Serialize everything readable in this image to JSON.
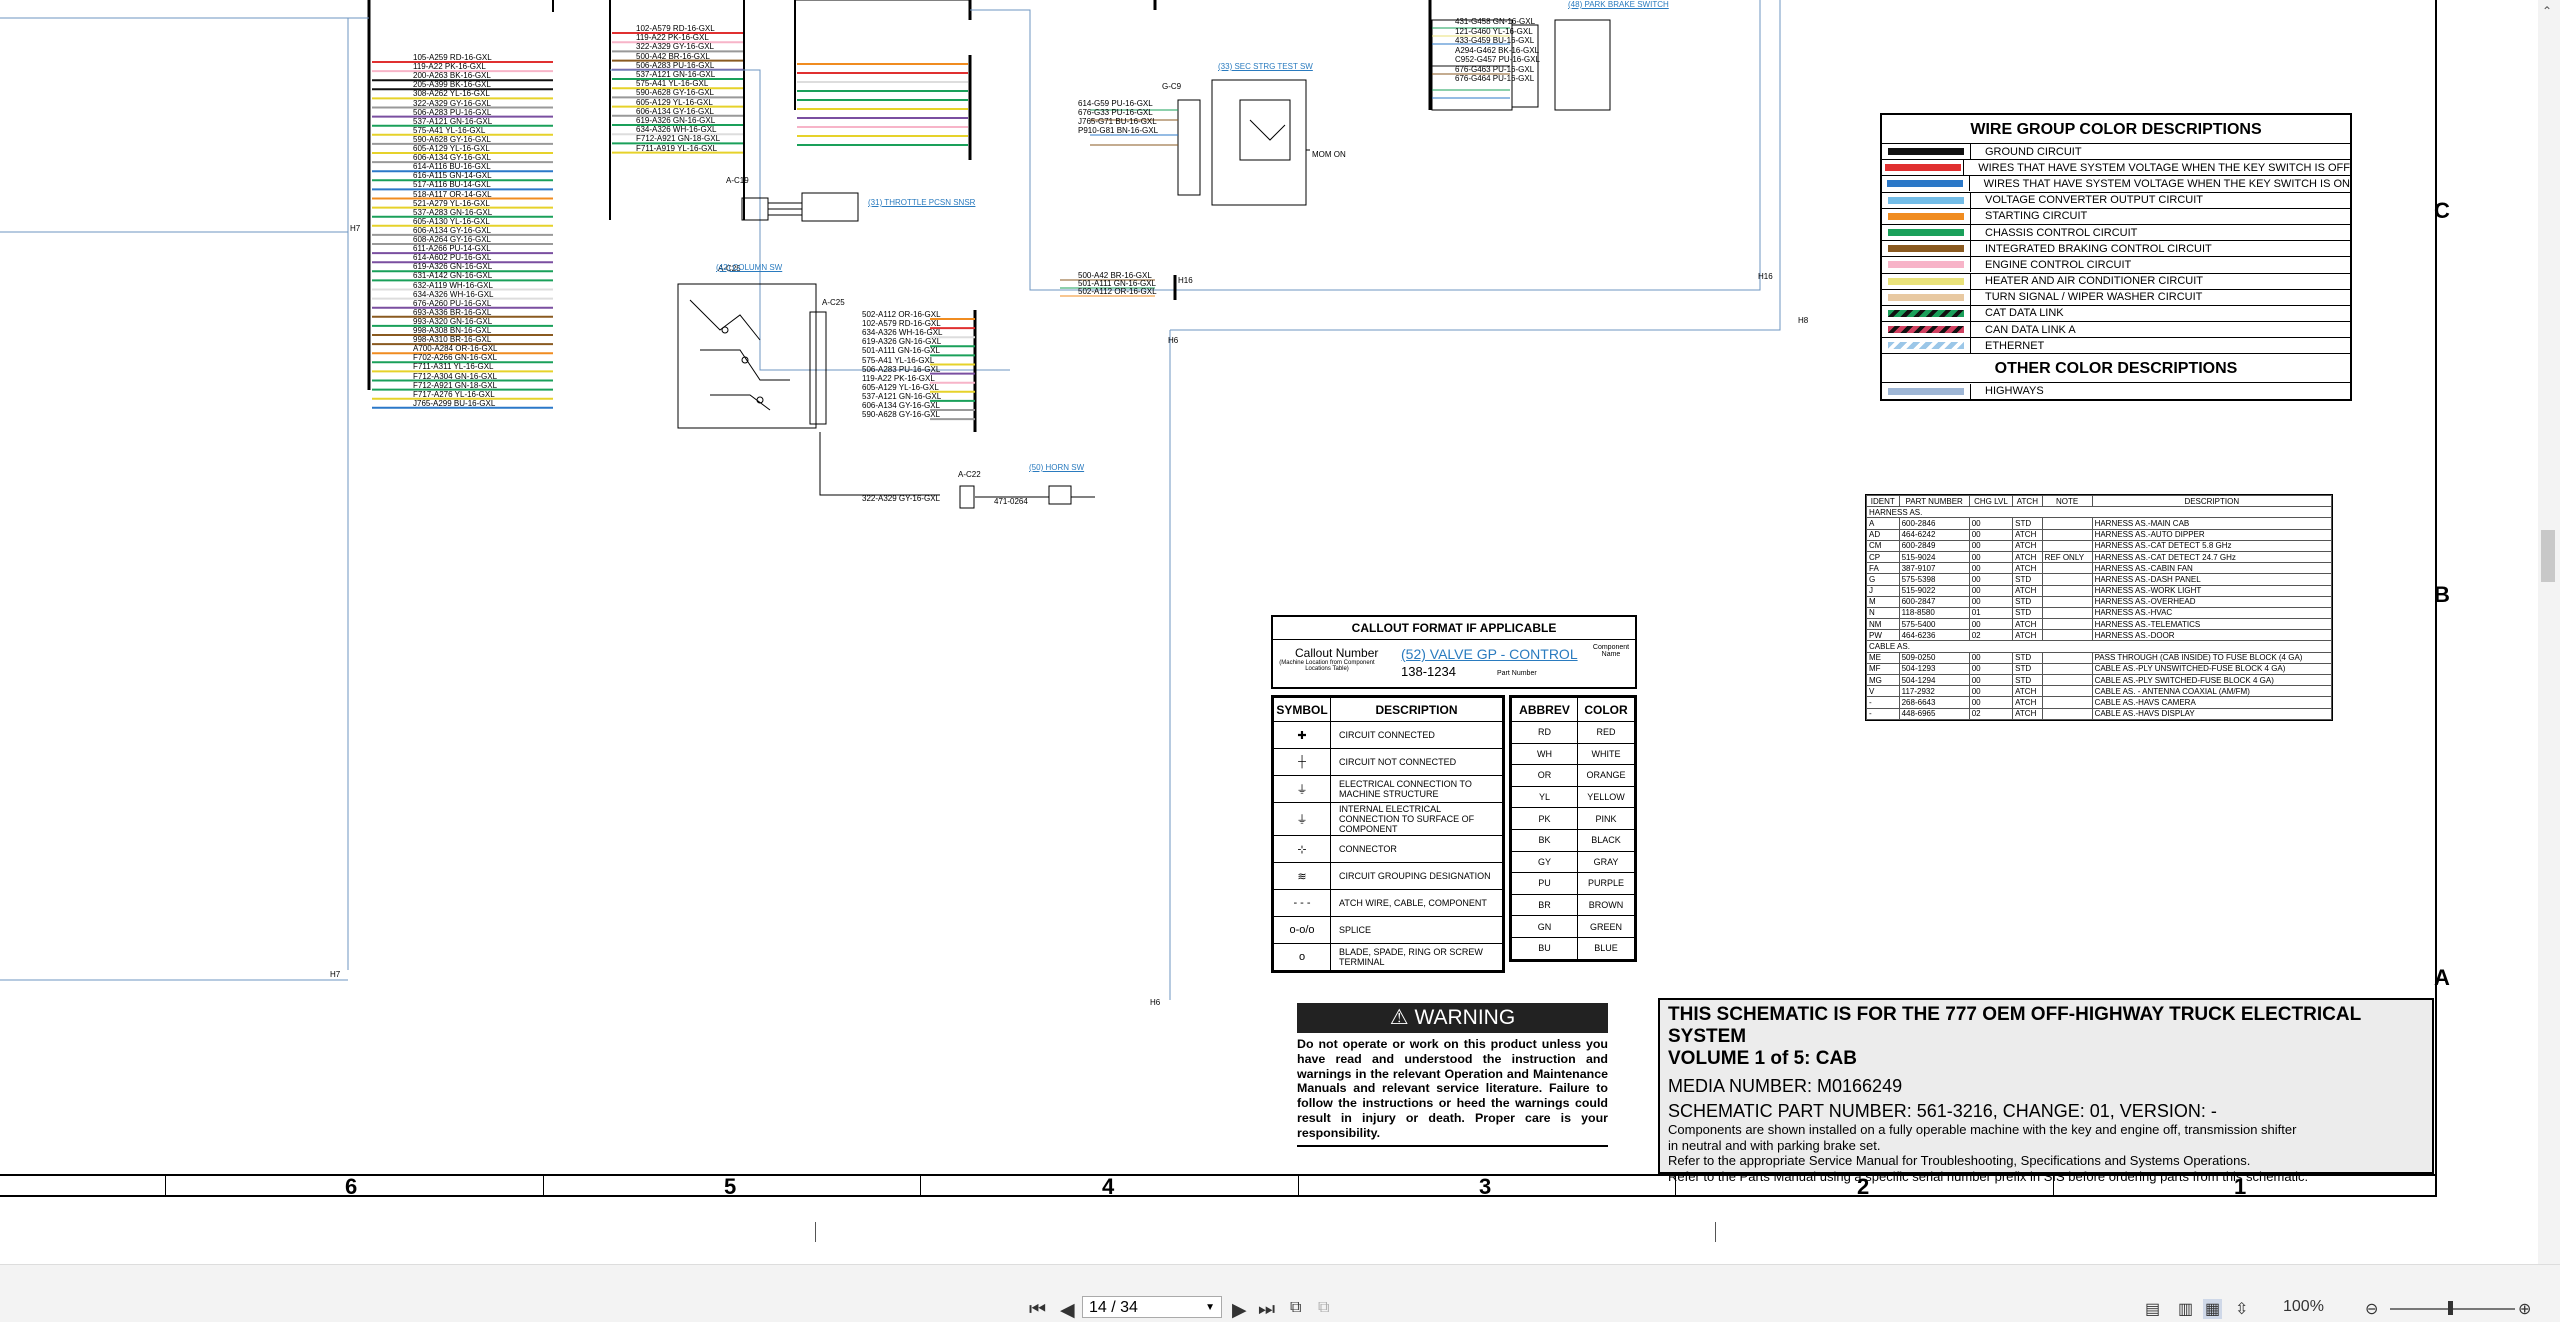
{
  "wire_group": {
    "title": "WIRE GROUP COLOR DESCRIPTIONS",
    "rows": [
      {
        "label": "GROUND CIRCUIT",
        "color": "#111111",
        "style": "solid"
      },
      {
        "label": "WIRES THAT HAVE SYSTEM VOLTAGE WHEN THE KEY SWITCH IS OFF",
        "color": "#e03030",
        "style": "solid"
      },
      {
        "label": "WIRES THAT HAVE SYSTEM VOLTAGE WHEN THE KEY SWITCH IS ON",
        "color": "#2b78c8",
        "style": "solid"
      },
      {
        "label": "VOLTAGE CONVERTER OUTPUT CIRCUIT",
        "color": "#73bde8",
        "style": "solid"
      },
      {
        "label": "STARTING CIRCUIT",
        "color": "#f08c20",
        "style": "solid"
      },
      {
        "label": "CHASSIS CONTROL CIRCUIT",
        "color": "#1aa05a",
        "style": "solid"
      },
      {
        "label": "INTEGRATED BRAKING CONTROL CIRCUIT",
        "color": "#8a5a20",
        "style": "solid"
      },
      {
        "label": "ENGINE CONTROL CIRCUIT",
        "color": "#f7b4c8",
        "style": "solid"
      },
      {
        "label": "HEATER AND AIR CONDITIONER CIRCUIT",
        "color": "#e9e27a",
        "style": "solid"
      },
      {
        "label": "TURN SIGNAL / WIPER WASHER CIRCUIT",
        "color": "#e8c9a2",
        "style": "solid"
      },
      {
        "label": "CAT DATA LINK",
        "color": "#1aa05a",
        "style": "stripe-dark"
      },
      {
        "label": "CAN DATA LINK A",
        "color": "#d04060",
        "style": "stripe-dark"
      },
      {
        "label": "ETHERNET",
        "color": "#9cc7e8",
        "style": "stripe-light"
      }
    ],
    "other_title": "OTHER COLOR DESCRIPTIONS",
    "other_rows": [
      {
        "label": "HIGHWAYS",
        "color": "#9fb7d6",
        "style": "solid"
      }
    ]
  },
  "callout": {
    "title": "CALLOUT FORMAT IF APPLICABLE",
    "callout_number": "Callout Number",
    "callout_sub": "(Machine Location from Component Locations Table)",
    "link": "(52) VALVE GP - CONTROL",
    "part": "138-1234",
    "component_name": "Component Name",
    "part_number": "Part Number"
  },
  "symbols": {
    "h_symbol": "SYMBOL",
    "h_desc": "DESCRIPTION",
    "rows": [
      {
        "sym": "✚",
        "desc": "CIRCUIT CONNECTED"
      },
      {
        "sym": "┼",
        "desc": "CIRCUIT NOT CONNECTED"
      },
      {
        "sym": "⏚",
        "desc": "ELECTRICAL CONNECTION TO MACHINE STRUCTURE"
      },
      {
        "sym": "⏚",
        "desc": "INTERNAL ELECTRICAL CONNECTION TO SURFACE OF COMPONENT"
      },
      {
        "sym": "⊹",
        "desc": "CONNECTOR"
      },
      {
        "sym": "≋",
        "desc": "CIRCUIT GROUPING DESIGNATION"
      },
      {
        "sym": "- - -",
        "desc": "ATCH WIRE, CABLE, COMPONENT"
      },
      {
        "sym": "o-o/o",
        "desc": "SPLICE"
      },
      {
        "sym": "o",
        "desc": "BLADE, SPADE, RING OR SCREW TERMINAL"
      }
    ]
  },
  "abbrevs": {
    "h_abbrev": "ABBREV",
    "h_color": "COLOR",
    "rows": [
      [
        "RD",
        "RED"
      ],
      [
        "WH",
        "WHITE"
      ],
      [
        "OR",
        "ORANGE"
      ],
      [
        "YL",
        "YELLOW"
      ],
      [
        "PK",
        "PINK"
      ],
      [
        "BK",
        "BLACK"
      ],
      [
        "GY",
        "GRAY"
      ],
      [
        "PU",
        "PURPLE"
      ],
      [
        "BR",
        "BROWN"
      ],
      [
        "GN",
        "GREEN"
      ],
      [
        "BU",
        "BLUE"
      ]
    ]
  },
  "parts": {
    "headers": [
      "IDENT",
      "PART NUMBER",
      "CHG LVL",
      "ATCH",
      "NOTE",
      "DESCRIPTION"
    ],
    "group1": "HARNESS AS.",
    "rows1": [
      [
        "A",
        "600-2846",
        "00",
        "STD",
        "",
        "HARNESS AS.-MAIN CAB"
      ],
      [
        "AD",
        "464-6242",
        "00",
        "ATCH",
        "",
        "HARNESS AS.-AUTO DIPPER"
      ],
      [
        "CM",
        "600-2849",
        "00",
        "ATCH",
        "",
        "HARNESS AS.-CAT DETECT 5.8 GHz"
      ],
      [
        "CP",
        "515-9024",
        "00",
        "ATCH",
        "REF ONLY",
        "HARNESS AS.-CAT DETECT 24.7 GHz"
      ],
      [
        "FA",
        "387-9107",
        "00",
        "ATCH",
        "",
        "HARNESS AS.-CABIN FAN"
      ],
      [
        "G",
        "575-5398",
        "00",
        "STD",
        "",
        "HARNESS AS.-DASH PANEL"
      ],
      [
        "J",
        "515-9022",
        "00",
        "ATCH",
        "",
        "HARNESS AS.-WORK LIGHT"
      ],
      [
        "M",
        "600-2847",
        "00",
        "STD",
        "",
        "HARNESS AS.-OVERHEAD"
      ],
      [
        "N",
        "118-8580",
        "01",
        "STD",
        "",
        "HARNESS AS.-HVAC"
      ],
      [
        "NM",
        "575-5400",
        "00",
        "ATCH",
        "",
        "HARNESS AS.-TELEMATICS"
      ],
      [
        "PW",
        "464-6236",
        "02",
        "ATCH",
        "",
        "HARNESS AS.-DOOR"
      ]
    ],
    "group2": "CABLE AS.",
    "rows2": [
      [
        "ME",
        "509-0250",
        "00",
        "STD",
        "",
        "PASS THROUGH (CAB INSIDE) TO FUSE BLOCK (4 GA)"
      ],
      [
        "MF",
        "504-1293",
        "00",
        "STD",
        "",
        "CABLE AS.-PLY UNSWITCHED-FUSE BLOCK 4 GA)"
      ],
      [
        "MG",
        "504-1294",
        "00",
        "STD",
        "",
        "CABLE AS.-PLY SWITCHED-FUSE BLOCK 4 GA)"
      ],
      [
        "V",
        "117-2932",
        "00",
        "ATCH",
        "",
        "CABLE AS. - ANTENNA COAXIAL (AM/FM)"
      ],
      [
        "-",
        "268-6643",
        "00",
        "ATCH",
        "",
        "CABLE AS.-HAVS CAMERA"
      ],
      [
        "-",
        "448-6965",
        "02",
        "ATCH",
        "",
        "CABLE AS.-HAVS DISPLAY"
      ]
    ]
  },
  "warning": {
    "title": "WARNING",
    "text": "Do not operate or work on this product unless you have read and understood the instruction and warnings in the relevant Operation and Maintenance Manuals and relevant service literature. Failure to follow the instructions or heed the warnings could result in injury or death. Proper care is your responsibility."
  },
  "title_block": {
    "line1": "THIS SCHEMATIC IS FOR THE 777 OEM OFF-HIGHWAY TRUCK ELECTRICAL SYSTEM",
    "line2": "VOLUME 1 of 5: CAB",
    "media": "MEDIA NUMBER: M0166249",
    "part": "SCHEMATIC PART NUMBER: 561-3216, CHANGE: 01, VERSION: -",
    "notes": [
      "Components are shown installed on a fully operable machine with the key and engine off, transmission shifter",
      "in neutral and with parking brake set.",
      "Refer to the appropriate Service Manual for Troubleshooting, Specifications and Systems Operations.",
      "Refer to the Parts Manual using a specific serial number prefix in SIS before ordering parts from this schematic."
    ]
  },
  "zones": [
    "6",
    "5",
    "4",
    "3",
    "2",
    "1"
  ],
  "row_labels": [
    "C",
    "B",
    "A"
  ],
  "schematic": {
    "links": [
      "(42) COLUMN SW",
      "(31) THROTTLE PCSN SNSR",
      "(33) SEC STRG TEST SW",
      "(50) HORN SW",
      "(48) PARK BRAKE SWITCH"
    ],
    "connectors": [
      "G-C9",
      "A-C19",
      "A-C25",
      "A-C22"
    ],
    "highways": [
      "H7",
      "H7",
      "H6",
      "H6",
      "H16",
      "H16",
      "H8"
    ],
    "mom_on": "MOM ON",
    "wires_left": [
      "105-A259 RD-16-GXL",
      "119-A22 PK-16-GXL",
      "200-A263 BK-16-GXL",
      "205-A399 BK-16-GXL",
      "308-A262 YL-16-GXL",
      "322-A329 GY-16-GXL",
      "506-A283 PU-16-GXL",
      "537-A121 GN-16-GXL",
      "575-A41 YL-16-GXL",
      "590-A628 GY-16-GXL",
      "605-A129 YL-16-GXL",
      "606-A134 GY-16-GXL",
      "614-A116 BU-16-GXL",
      "616-A115 GN-14-GXL",
      "517-A116 BU-14-GXL",
      "518-A117 OR-14-GXL",
      "521-A279 YL-16-GXL",
      "537-A283 GN-16-GXL",
      "605-A130 YL-16-GXL",
      "606-A134 GY-16-GXL",
      "608-A264 GY-16-GXL",
      "611-A266 PU-14-GXL",
      "614-A602 PU-16-GXL",
      "619-A326 GN-16-GXL",
      "631-A142 GN-16-GXL",
      "632-A119 WH-16-GXL",
      "634-A326 WH-16-GXL",
      "676-A260 PU-16-GXL",
      "693-A336 BR-16-GXL",
      "993-A320 GN-16-GXL",
      "998-A308 BN-16-GXL",
      "998-A310 BR-16-GXL",
      "A700-A284 OR-16-GXL",
      "F702-A266 GN-16-GXL",
      "F711-A311 YL-16-GXL",
      "F712-A304 GN-16-GXL",
      "F712-A921 GN-18-GXL",
      "F717-A276 YL-16-GXL",
      "J765-A299 BU-16-GXL"
    ],
    "wires_mid": [
      "102-A579 RD-16-GXL",
      "119-A22 PK-16-GXL",
      "322-A329 GY-16-GXL",
      "500-A42 BR-16-GXL",
      "506-A283 PU-16-GXL",
      "537-A121 GN-16-GXL",
      "575-A41 YL-16-GXL",
      "590-A628 GY-16-GXL",
      "605-A129 YL-16-GXL",
      "606-A134 GY-16-GXL",
      "619-A326 GN-16-GXL",
      "634-A326 WH-16-GXL",
      "F712-A921 GN-18-GXL",
      "F711-A919 YL-16-GXL"
    ],
    "wires_c25": [
      "502-A112 OR-16-GXL",
      "102-A579 RD-16-GXL",
      "634-A326 WH-16-GXL",
      "619-A326 GN-16-GXL",
      "501-A111 GN-16-GXL",
      "575-A41 YL-16-GXL",
      "506-A283 PU-16-GXL",
      "119-A22 PK-16-GXL",
      "605-A129 YL-16-GXL",
      "537-A121 GN-16-GXL",
      "606-A134 GY-16-GXL",
      "590-A628 GY-16-GXL"
    ],
    "wires_h16": [
      "500-A42 BR-16-GXL",
      "501-A111 GN-16-GXL",
      "502-A112 OR-16-GXL"
    ],
    "wires_c9": [
      "614-G59 PU-16-GXL",
      "676-G33 PU-16-GXL",
      "J765-G71 BU-16-GXL",
      "P910-G81 BN-16-GXL"
    ],
    "wires_tr": [
      "431-G458 GN-16-GXL",
      "121-G460 YL-16-GXL",
      "433-G459 BU-16-GXL",
      "A294-G462 BK-16-GXL",
      "C952-G457 PU-16-GXL",
      "676-G463 PU-16-GXL",
      "676-G464 PU-16-GXL"
    ],
    "c22_wire": "322-A329 GY-16-GXL",
    "c22_part": "471-0264"
  },
  "viewer": {
    "page": "14 / 34",
    "zoom": "100%"
  }
}
